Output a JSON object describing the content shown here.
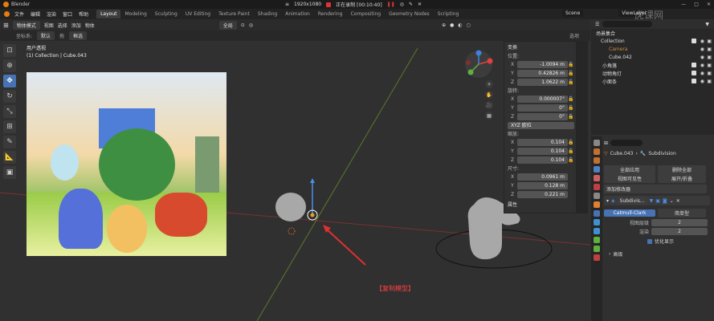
{
  "window": {
    "app_name": "Blender",
    "minimize_glyph": "—",
    "maximize_glyph": "□",
    "close_glyph": "✕"
  },
  "recorder": {
    "resolution": "1920x1080",
    "status": "正在录制 [00:10:40]",
    "menu_glyph": "≡",
    "pause_glyph": "❚❚",
    "camera_glyph": "◎",
    "brush_glyph": "✎",
    "close_glyph": "✕"
  },
  "menu": [
    "文件",
    "编辑",
    "渲染",
    "窗口",
    "帮助"
  ],
  "tabs": [
    "Layout",
    "Modeling",
    "Sculpting",
    "UV Editing",
    "Texture Paint",
    "Shading",
    "Animation",
    "Rendering",
    "Compositing",
    "Geometry Nodes",
    "Scripting"
  ],
  "active_tab": "Layout",
  "scene": {
    "label": "Scene",
    "view_layer": "ViewLayer"
  },
  "viewport_header": {
    "mode": "物体模式",
    "menus": [
      "视图",
      "选择",
      "添加",
      "物体"
    ],
    "transform": "全局",
    "options": "选项"
  },
  "viewport_header2": {
    "coord_label": "坐标系:",
    "coord_value": "默认",
    "drag_label": "拖",
    "drag_value": "框选"
  },
  "viewport_info": {
    "view": "用户透视",
    "collection": "(1) Collection | Cube.043"
  },
  "toolbar_icons": [
    "⊡",
    "⊕",
    "✥",
    "↻",
    "⤡",
    "⊞",
    "✎",
    "📐",
    "▣"
  ],
  "nav_buttons": [
    "+",
    "✋",
    "🎥",
    "▦"
  ],
  "transform": {
    "header": "变换",
    "location_label": "位置:",
    "location": [
      "-1.0094 m",
      "0.42826 m",
      "1.0622 m"
    ],
    "rotation_label": "旋转:",
    "rotation": [
      "0.000007°",
      "0°",
      "0°"
    ],
    "rotation_mode": "XYZ 欧拉",
    "scale_label": "缩放:",
    "scale": [
      "0.104",
      "0.104",
      "0.104"
    ],
    "dimensions_label": "尺寸:",
    "dimensions": [
      "0.0961 m",
      "0.128 m",
      "0.221 m"
    ],
    "properties": "属性",
    "axes": [
      "X",
      "Y",
      "Z"
    ]
  },
  "outliner": {
    "title": "场景集合",
    "items": [
      "Collection",
      "Camera",
      "Cube.042",
      "小角落",
      "动物角灯",
      "小面条"
    ]
  },
  "properties": {
    "object": "Cube.043",
    "modifier": "Subdivision",
    "apply_all": "全部应用",
    "delete_all": "删除全部",
    "viewport_vis": "视图可见性",
    "toggle_stack": "展开/折叠",
    "add_modifier": "添加修改器",
    "mod_name": "Subdivis...",
    "catmull": "Catmull-Clark",
    "simple": "简单型",
    "levels_viewport_label": "视图层级",
    "levels_viewport": "2",
    "render_label": "渲染",
    "render": "2",
    "optimal": "优化显示",
    "advanced": "高级"
  },
  "subtitle": "【复制模型】",
  "watermark": "虎课网",
  "icons": [
    "blender-logo",
    "record-icon",
    "search-icon",
    "eye-icon",
    "camera-icon",
    "gizmo-icon"
  ],
  "colors": {
    "accent": "#4772b3",
    "orange": "#e87d0d",
    "red_text": "#ff4040"
  }
}
